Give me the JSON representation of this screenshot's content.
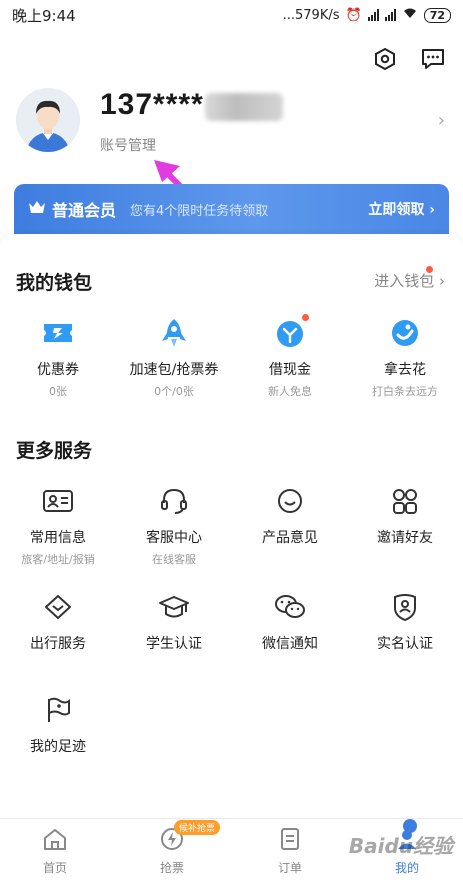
{
  "status_bar": {
    "time": "晚上9:44",
    "network_speed": "...579K/s",
    "battery": "72"
  },
  "profile": {
    "username": "137****",
    "account_link": "账号管理"
  },
  "member": {
    "title": "普通会员",
    "tip": "您有4个限时任务待领取",
    "cta": "立即领取 ›"
  },
  "wallet": {
    "title": "我的钱包",
    "link": "进入钱包 ›",
    "items": [
      {
        "label": "优惠券",
        "sub": "0张"
      },
      {
        "label": "加速包/抢票券",
        "sub": "0个/0张"
      },
      {
        "label": "借现金",
        "sub": "新人免息"
      },
      {
        "label": "拿去花",
        "sub": "打白条去远方"
      }
    ]
  },
  "services": {
    "title": "更多服务",
    "items": [
      {
        "label": "常用信息",
        "sub": "旅客/地址/报销"
      },
      {
        "label": "客服中心",
        "sub": "在线客服"
      },
      {
        "label": "产品意见",
        "sub": ""
      },
      {
        "label": "邀请好友",
        "sub": ""
      },
      {
        "label": "出行服务",
        "sub": ""
      },
      {
        "label": "学生认证",
        "sub": ""
      },
      {
        "label": "微信通知",
        "sub": ""
      },
      {
        "label": "实名认证",
        "sub": ""
      },
      {
        "label": "我的足迹",
        "sub": ""
      }
    ]
  },
  "tabbar": {
    "tabs": [
      {
        "label": "首页"
      },
      {
        "label": "抢票",
        "badge": "候补抢票"
      },
      {
        "label": "订单"
      },
      {
        "label": "我的"
      }
    ]
  },
  "watermark": "Baidu经验",
  "colors": {
    "accent": "#3e7de0",
    "badge": "#ff9c2a",
    "dot": "#ff5a3c",
    "arrow": "#e23be0"
  }
}
